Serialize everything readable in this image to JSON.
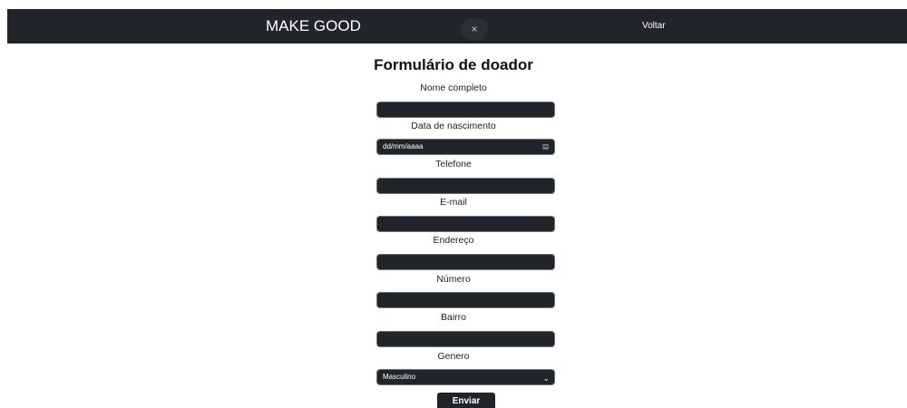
{
  "navbar": {
    "brand": "MAKE GOOD",
    "close_symbol": "×",
    "back_link": "Voltar"
  },
  "form": {
    "title": "Formulário de doador",
    "fields": {
      "nome": {
        "label": "Nome completo",
        "value": ""
      },
      "nascimento": {
        "label": "Data de nascimento",
        "placeholder": "dd/mm/aaaa"
      },
      "telefone": {
        "label": "Telefone",
        "value": ""
      },
      "email": {
        "label": "E-mail",
        "value": ""
      },
      "endereco": {
        "label": "Endereço",
        "value": ""
      },
      "numero": {
        "label": "Número",
        "value": ""
      },
      "bairro": {
        "label": "Bairro",
        "value": ""
      },
      "genero": {
        "label": "Genero",
        "selected": "Masculino"
      }
    },
    "submit_label": "Enviar"
  },
  "icons": {
    "close": "close-icon",
    "calendar": "calendar-icon",
    "select_arrow": "chevron-down-icon"
  },
  "colors": {
    "navbar_bg": "#212529",
    "input_bg": "#212529",
    "button_bg": "#212529",
    "text_light": "#ffffff"
  }
}
